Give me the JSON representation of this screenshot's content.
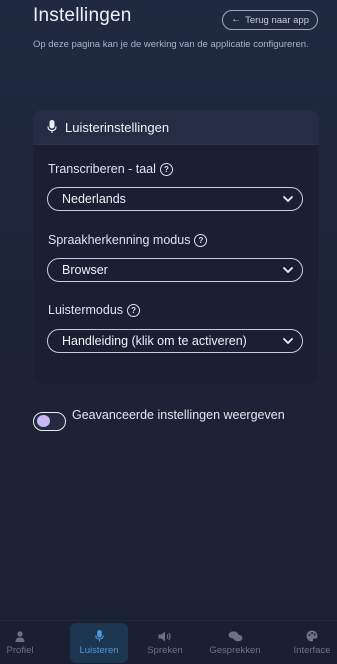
{
  "page": {
    "title": "Instellingen",
    "back_label": "Terug naar app",
    "description": "Op deze pagina kan je de werking van de applicatie configureren."
  },
  "card": {
    "title": "Luisterinstellingen",
    "fields": [
      {
        "label": "Transcriberen - taal",
        "value": "Nederlands"
      },
      {
        "label": "Spraakherkenning modus",
        "value": "Browser"
      },
      {
        "label": "Luistermodus",
        "value": "Handleiding (klik om te activeren)"
      }
    ]
  },
  "advanced_toggle": {
    "label": "Geavanceerde instellingen weergeven",
    "on": false
  },
  "nav": {
    "items": [
      {
        "label": "Profiel",
        "icon": "person-icon",
        "active": false
      },
      {
        "label": "Luisteren",
        "icon": "microphone-icon",
        "active": true
      },
      {
        "label": "Spreken",
        "icon": "speaker-icon",
        "active": false
      },
      {
        "label": "Gesprekken",
        "icon": "chat-bubbles-icon",
        "active": false
      },
      {
        "label": "Interface",
        "icon": "palette-icon",
        "active": false
      }
    ]
  },
  "colors": {
    "background": "#1d2438",
    "card": "#192033",
    "accent_active": "#4e97d8",
    "toggle_knob": "#c9b8f3"
  }
}
